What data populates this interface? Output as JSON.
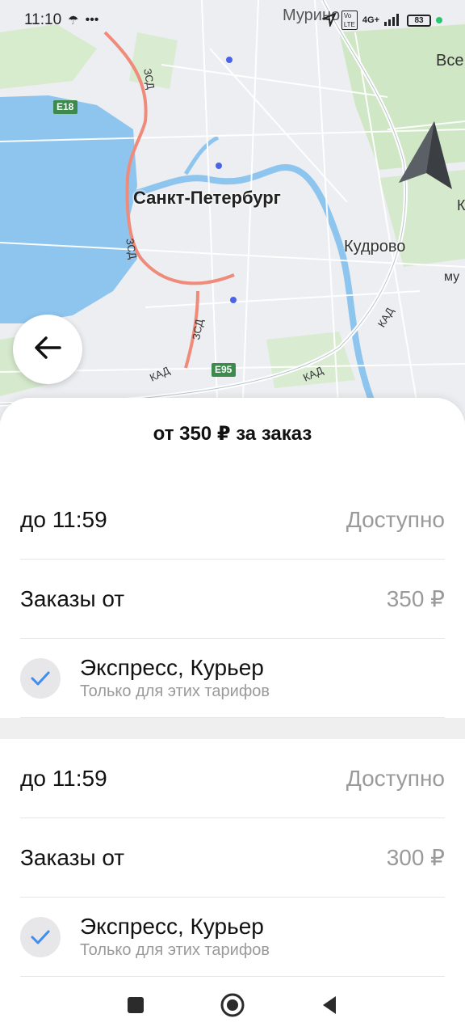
{
  "status_bar": {
    "time": "11:10",
    "network": "4G+",
    "battery": "83",
    "icons": [
      "umbrella-icon",
      "more-icon",
      "location-arrow-icon",
      "volte-icon",
      "signal-icon",
      "battery-icon"
    ]
  },
  "map": {
    "city_label": "Санкт-Петербург",
    "labels": {
      "murino": "Мурино",
      "vse": "Все",
      "kudrovo": "Кудрово",
      "e18": "E18",
      "e95": "E95",
      "zsd": "ЗСД",
      "kad": "КАД",
      "mu": "му",
      "k": "К"
    },
    "colors": {
      "water": "#8ec5ee",
      "park": "#cfe7c4",
      "road": "#ffffff",
      "traffic": "#f08a7a"
    }
  },
  "back_button": {
    "icon": "arrow-left-icon"
  },
  "sheet": {
    "title": "от 350 ₽ за заказ",
    "blocks": [
      {
        "time_label": "до 11:59",
        "status": "Доступно",
        "orders_label": "Заказы от",
        "orders_price": "350 ₽",
        "tariffs": "Экспресс, Курьер",
        "tariffs_note": "Только для этих тарифов"
      },
      {
        "time_label": "до 11:59",
        "status": "Доступно",
        "orders_label": "Заказы от",
        "orders_price": "300 ₽",
        "tariffs": "Экспресс, Курьер",
        "tariffs_note": "Только для этих тарифов"
      }
    ]
  },
  "nav_bar": {
    "icons": [
      "square-icon",
      "home-circle-icon",
      "back-triangle-icon"
    ]
  }
}
